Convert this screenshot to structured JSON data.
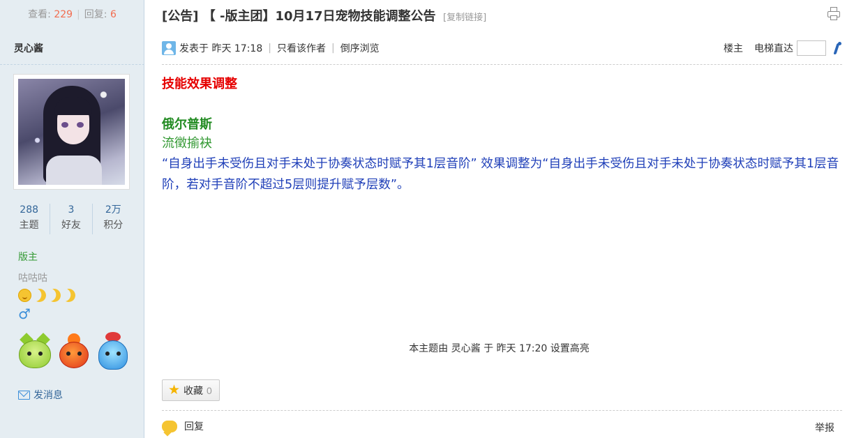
{
  "sidebar": {
    "views_label": "查看:",
    "views_count": "229",
    "replies_label": "回复:",
    "replies_count": "6",
    "author": "灵心酱",
    "stats": [
      {
        "value": "288",
        "label": "主题"
      },
      {
        "value": "3",
        "label": "好友"
      },
      {
        "value": "2万",
        "label": "积分"
      }
    ],
    "group": "版主",
    "status_text": "咕咕咕",
    "gender_symbol": "♂",
    "send_message": "发消息"
  },
  "post": {
    "title": "[公告] 【 -版主团】10月17日宠物技能调整公告",
    "copy_link": "[复制链接]",
    "posted_prefix": "发表于",
    "posted_time": "昨天 17:18",
    "only_author": "只看该作者",
    "reverse_order": "倒序浏览",
    "floor": "楼主",
    "elevator": "电梯直达",
    "content": {
      "heading": "技能效果调整",
      "pet_name": "俄尔普斯",
      "skill_name": "流徵揄袂",
      "description": "“自身出手未受伤且对手未处于协奏状态时赋予其1层音阶” 效果调整为“自身出手未受伤且对手未处于协奏状态时赋予其1层音阶，若对手音阶不超过5层则提升赋予层数”。"
    },
    "highlight_note": "本主题由 灵心酱 于 昨天 17:20 设置高亮",
    "favorite_label": "收藏",
    "favorite_count": "0",
    "reply": "回复",
    "report": "举报"
  },
  "icons": {
    "star": "★"
  },
  "colors": {
    "heading_red": "#e60000",
    "pet_green": "#228b22",
    "desc_blue": "#1f3fb8",
    "sidebar_bg": "#e5edf2"
  }
}
